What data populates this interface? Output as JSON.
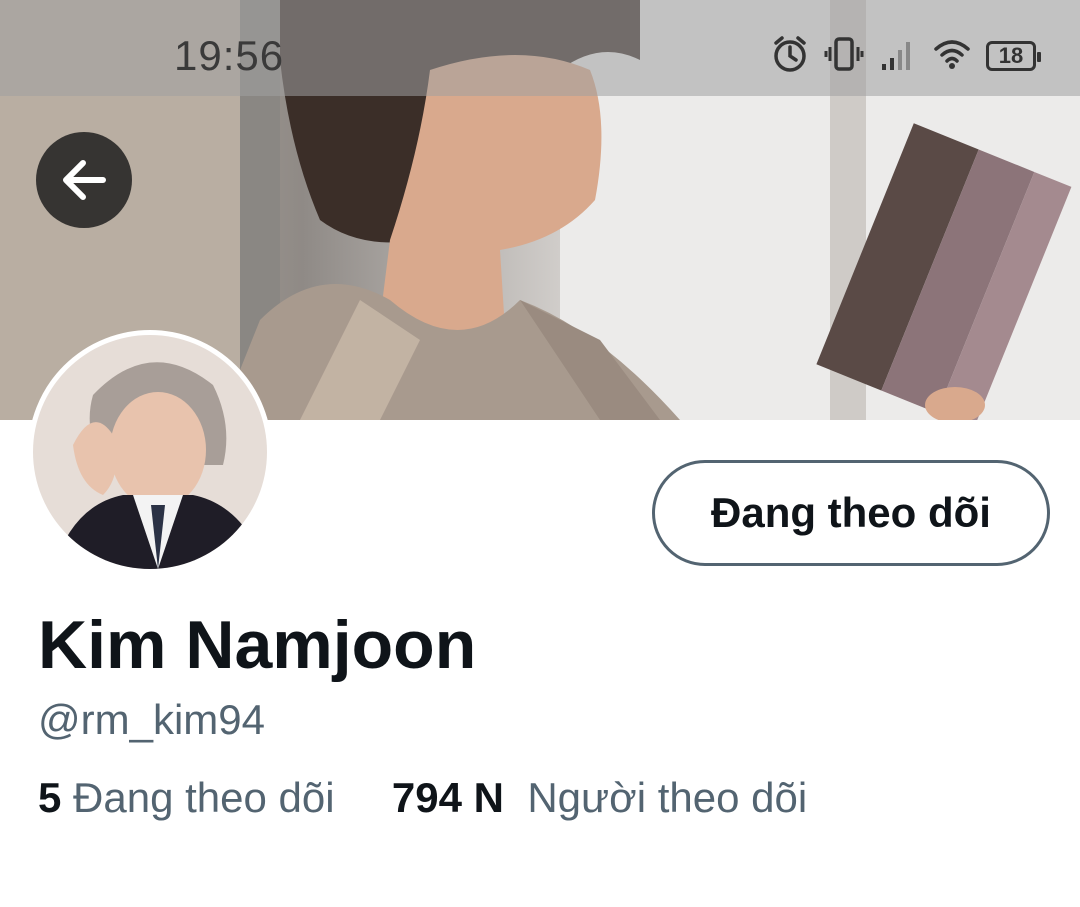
{
  "status_bar": {
    "time": "19:56",
    "battery_level": "18",
    "icons": [
      "alarm-icon",
      "vibrate-icon",
      "signal-icon",
      "wifi-icon",
      "battery-icon"
    ]
  },
  "header": {
    "back_icon": "arrow-left-icon"
  },
  "profile": {
    "follow_button_label": "Đang theo dõi",
    "name": "Kim Namjoon",
    "handle": "@rm_kim94",
    "following_count": "5",
    "following_label": "Đang theo dõi",
    "followers_count": "794 N",
    "followers_label": "Người theo dõi"
  },
  "colors": {
    "text_primary": "#0f1419",
    "text_secondary": "#536471",
    "button_border": "#536471"
  }
}
